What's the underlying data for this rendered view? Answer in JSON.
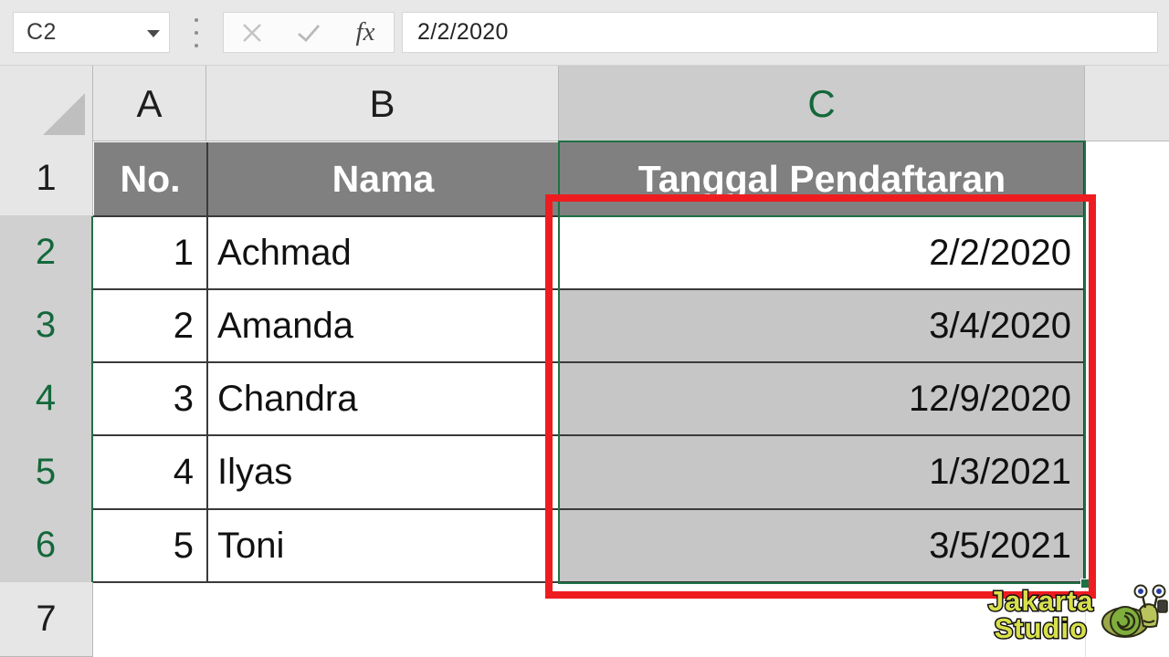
{
  "formula_bar": {
    "name_box_value": "C2",
    "name_box_icon": "chevron-down-icon",
    "grip_icon": "vertical-dots-grip-icon",
    "cancel_icon": "cancel-x-icon",
    "confirm_icon": "confirm-check-icon",
    "function_label": "fx",
    "formula_value": "2/2/2020"
  },
  "grid": {
    "column_headers": [
      "A",
      "B",
      "C"
    ],
    "active_column": "C",
    "row_headers": [
      "1",
      "2",
      "3",
      "4",
      "5",
      "6",
      "7"
    ],
    "selected_rows": [
      "2",
      "3",
      "4",
      "5",
      "6"
    ],
    "table_headers": [
      "No.",
      "Nama",
      "Tanggal Pendaftaran"
    ],
    "rows": [
      {
        "no": "1",
        "nama": "Achmad",
        "tanggal": "2/2/2020"
      },
      {
        "no": "2",
        "nama": "Amanda",
        "tanggal": "3/4/2020"
      },
      {
        "no": "3",
        "nama": "Chandra",
        "tanggal": "12/9/2020"
      },
      {
        "no": "4",
        "nama": "Ilyas",
        "tanggal": "1/3/2021"
      },
      {
        "no": "5",
        "nama": "Toni",
        "tanggal": "3/5/2021"
      }
    ],
    "selection_range": "C1:C6",
    "active_cell": "C2"
  },
  "annotation": {
    "highlight_color": "#ee1c20",
    "selection_color": "#1e7145",
    "header_fill": "#808080",
    "selected_fill": "#c6c6c6"
  },
  "watermark": {
    "line1": "Jakarta",
    "line2": "Studio",
    "mascot_icon": "snail-mascot-icon"
  }
}
